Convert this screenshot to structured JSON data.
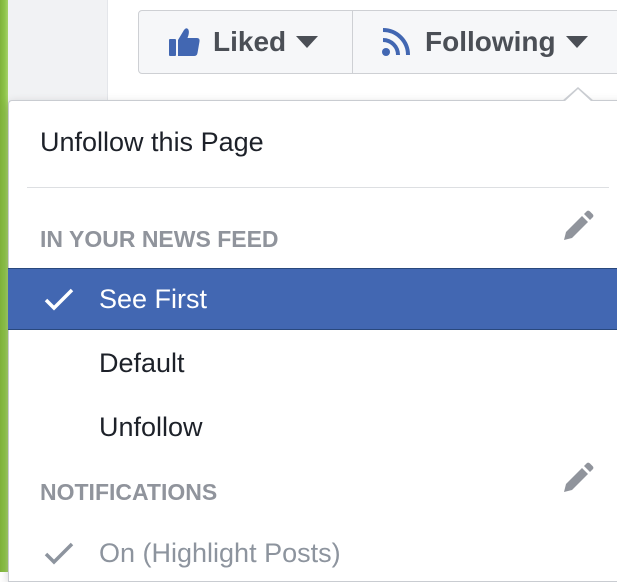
{
  "buttons": {
    "liked_label": "Liked",
    "following_label": "Following"
  },
  "menu": {
    "unfollow_page": "Unfollow this Page",
    "news_feed_header": "IN YOUR NEWS FEED",
    "news_feed_options": [
      "See First",
      "Default",
      "Unfollow"
    ],
    "selected_option": "See First",
    "notifications_header": "NOTIFICATIONS",
    "notifications_option": "On (Highlight Posts)"
  },
  "icons": [
    "thumbs-up-icon",
    "rss-icon",
    "chevron-down-icon",
    "check-icon",
    "pencil-icon"
  ],
  "colors": {
    "accent": "#4267b2",
    "button_bg": "#f6f7f9",
    "header_gray": "#90949c",
    "green_edge": "#8ec44a"
  }
}
